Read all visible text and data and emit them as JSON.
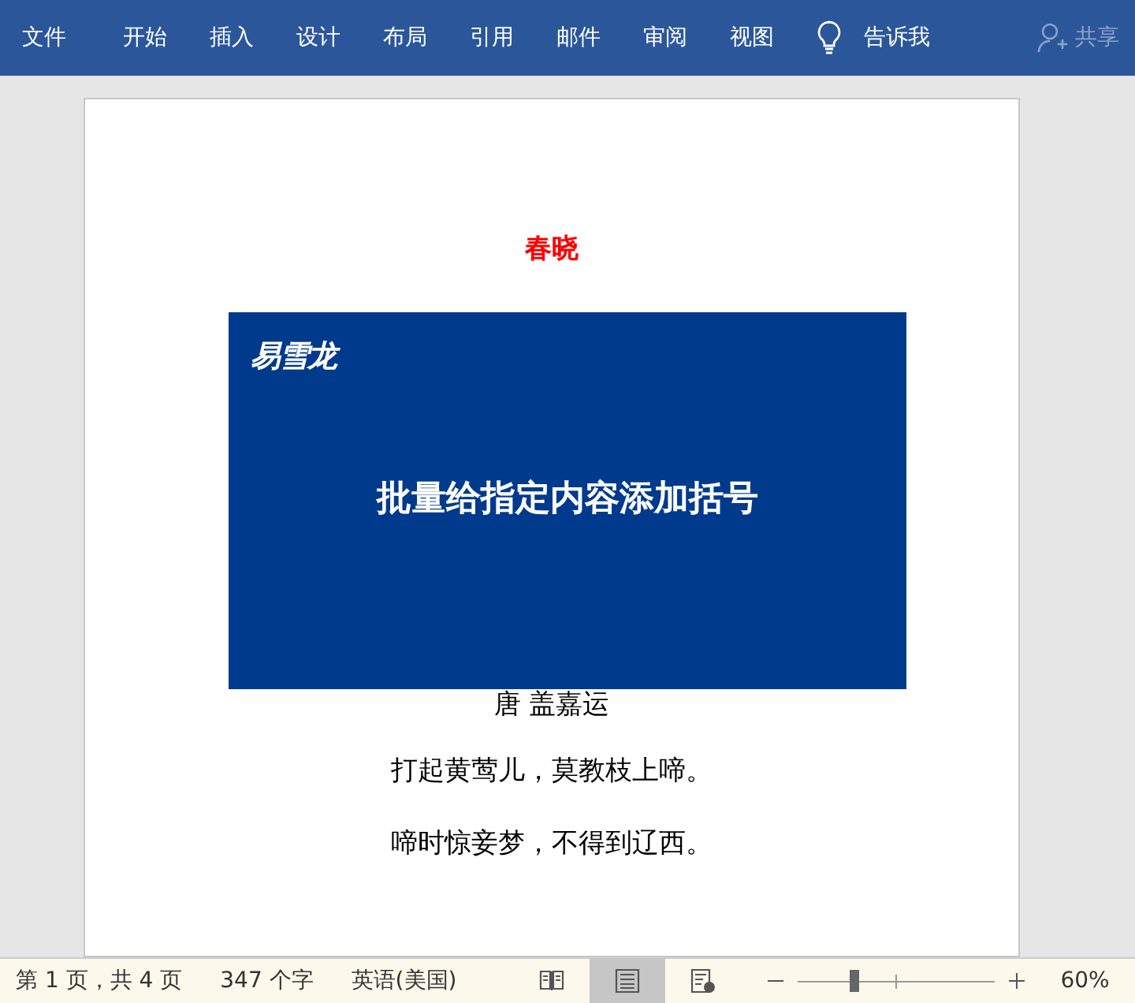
{
  "ribbon": {
    "tabs": [
      {
        "label": "文件",
        "kind": "file"
      },
      {
        "label": "开始",
        "kind": "tab"
      },
      {
        "label": "插入",
        "kind": "tab"
      },
      {
        "label": "设计",
        "kind": "tab"
      },
      {
        "label": "布局",
        "kind": "tab"
      },
      {
        "label": "引用",
        "kind": "tab"
      },
      {
        "label": "邮件",
        "kind": "tab"
      },
      {
        "label": "审阅",
        "kind": "tab"
      },
      {
        "label": "视图",
        "kind": "tab"
      }
    ],
    "tell_me": "告诉我",
    "share": {
      "label": "共享",
      "disabled": true
    }
  },
  "document": {
    "title": "春晓",
    "lines": [
      "唐 盖嘉运",
      "打起黄莺儿，莫教枝上啼。",
      "啼时惊妾梦，不得到辽西。"
    ]
  },
  "overlay": {
    "brand": "易雪龙",
    "headline": "批量给指定内容添加括号"
  },
  "status_bar": {
    "page": "第 1 页，共 4 页",
    "words": "347 个字",
    "language": "英语(美国)",
    "views": [
      {
        "kind": "read",
        "selected": false
      },
      {
        "kind": "print",
        "selected": true
      },
      {
        "kind": "web",
        "selected": false
      }
    ],
    "zoom": {
      "level": 0.29,
      "reading": "60%"
    }
  }
}
